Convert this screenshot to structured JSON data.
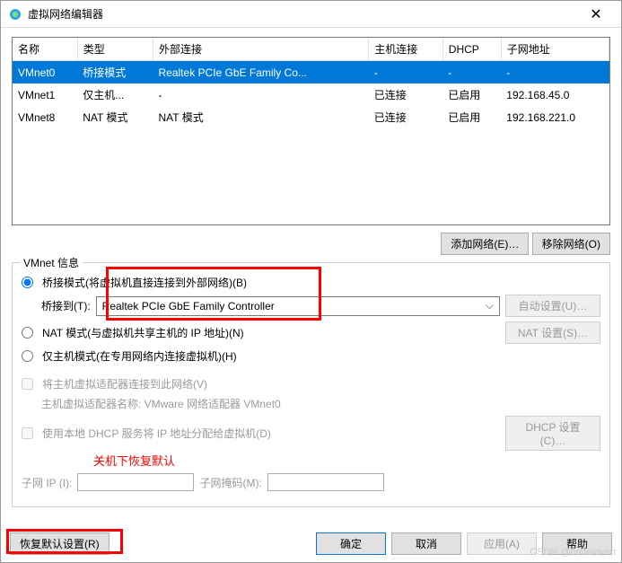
{
  "window": {
    "title": "虚拟网络编辑器",
    "close": "✕"
  },
  "table": {
    "headers": [
      "名称",
      "类型",
      "外部连接",
      "主机连接",
      "DHCP",
      "子网地址"
    ],
    "rows": [
      {
        "name": "VMnet0",
        "type": "桥接模式",
        "ext": "Realtek PCIe GbE Family Co...",
        "host": "-",
        "dhcp": "-",
        "subnet": "-",
        "selected": true
      },
      {
        "name": "VMnet1",
        "type": "仅主机...",
        "ext": "-",
        "host": "已连接",
        "dhcp": "已启用",
        "subnet": "192.168.45.0",
        "selected": false
      },
      {
        "name": "VMnet8",
        "type": "NAT 模式",
        "ext": "NAT 模式",
        "host": "已连接",
        "dhcp": "已启用",
        "subnet": "192.168.221.0",
        "selected": false
      }
    ]
  },
  "buttons": {
    "add_net": "添加网络(E)…",
    "remove_net": "移除网络(O)",
    "auto_set": "自动设置(U)…",
    "nat_set": "NAT 设置(S)…",
    "dhcp_set": "DHCP 设置(C)…",
    "restore": "恢复默认设置(R)",
    "ok": "确定",
    "cancel": "取消",
    "apply": "应用(A)",
    "help": "帮助"
  },
  "group": {
    "legend": "VMnet 信息",
    "bridge_mode": "桥接模式(将虚拟机直接连接到外部网络)(B)",
    "bridge_to": "桥接到(T):",
    "bridge_adapter": "Realtek PCIe GbE Family Controller",
    "nat_mode": "NAT 模式(与虚拟机共享主机的 IP 地址)(N)",
    "host_only": "仅主机模式(在专用网络内连接虚拟机)(H)",
    "connect_host": "将主机虚拟适配器连接到此网络(V)",
    "host_adapter_name": "主机虚拟适配器名称: VMware 网络适配器 VMnet0",
    "use_dhcp": "使用本地 DHCP 服务将 IP 地址分配给虚拟机(D)",
    "subnet_ip": "子网 IP (I):",
    "subnet_mask": "子网掩码(M):",
    "red_note": "关机下恢复默认"
  },
  "watermark": "CSDN @codeloverr"
}
